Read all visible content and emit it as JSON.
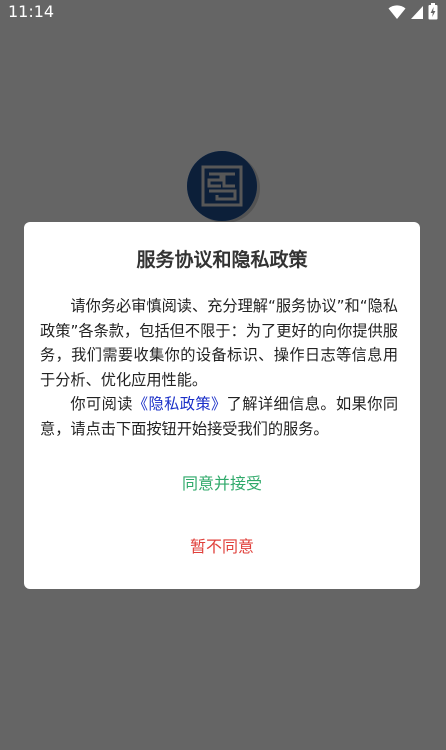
{
  "status_bar": {
    "time": "11:14",
    "icons": [
      "wifi-icon",
      "cell-signal-icon",
      "battery-charging-icon"
    ]
  },
  "app": {
    "logo_icon": "app-logo-icon"
  },
  "dialog": {
    "title": "服务协议和隐私政策",
    "paragraph1": "请你务必审慎阅读、充分理解“服务协议”和“隐私政策”各条款，包括但不限于：为了更好的向你提供服务，我们需要收集你的设备标识、操作日志等信息用于分析、优化应用性能。",
    "paragraph2_prefix": "你可阅读",
    "privacy_link": "《隐私政策》",
    "paragraph2_suffix": "了解详细信息。如果你同意，请点击下面按钮开始接受我们的服务。",
    "agree_label": "同意并接受",
    "disagree_label": "暂不同意"
  },
  "colors": {
    "background_dim": "#656565",
    "link": "#1a2fc8",
    "agree": "#2fa96a",
    "disagree": "#e0403b",
    "logo_blue": "#1f4f8f"
  }
}
